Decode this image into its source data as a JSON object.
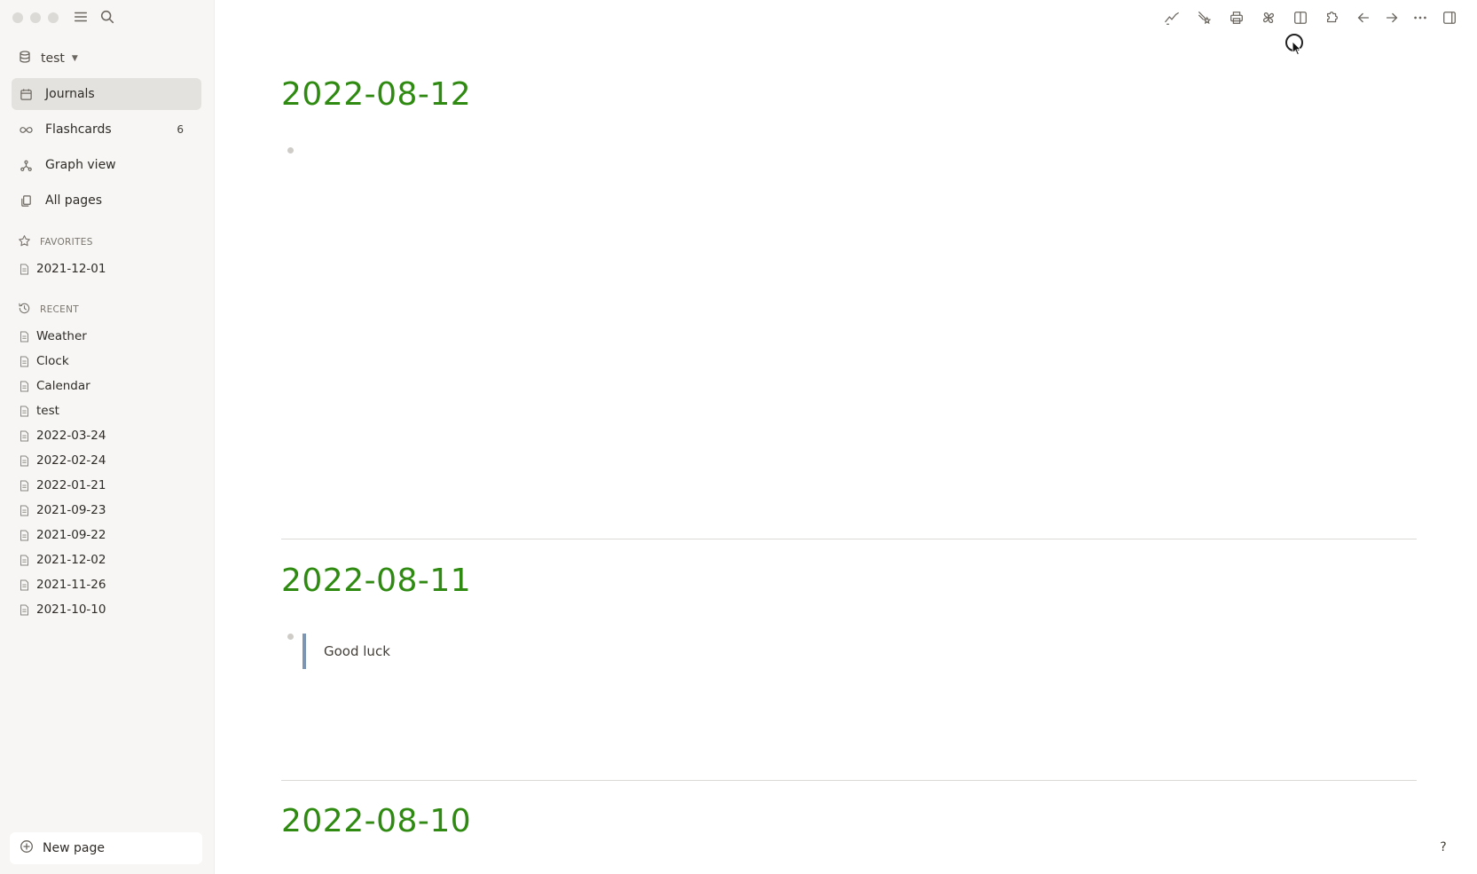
{
  "sidebar": {
    "graph_name": "test",
    "nav": [
      {
        "label": "Journals",
        "icon": "calendar-icon",
        "active": true
      },
      {
        "label": "Flashcards",
        "icon": "infinity-icon",
        "count": "6"
      },
      {
        "label": "Graph view",
        "icon": "graph-icon"
      },
      {
        "label": "All pages",
        "icon": "pages-icon"
      }
    ],
    "favorites_header": "FAVORITES",
    "favorites": [
      "2021-12-01"
    ],
    "recent_header": "RECENT",
    "recent": [
      "Weather",
      "Clock",
      "Calendar",
      "test",
      "2022-03-24",
      "2022-02-24",
      "2022-01-21",
      "2021-09-23",
      "2021-09-22",
      "2021-12-02",
      "2021-11-26",
      "2021-10-10"
    ],
    "new_page_label": "New page"
  },
  "toolbar": {
    "icons": [
      "trend-icon",
      "sparkle-icon",
      "print-icon",
      "puzzle-flower-icon",
      "split-view-icon",
      "plugin-icon",
      "back-arrow-icon",
      "forward-arrow-icon",
      "more-icon",
      "right-sidebar-icon"
    ]
  },
  "journals": [
    {
      "title": "2022-08-12",
      "blocks": []
    },
    {
      "title": "2022-08-11",
      "blocks": [
        {
          "type": "quote",
          "text": "Good luck"
        }
      ]
    },
    {
      "title": "2022-08-10",
      "blocks": []
    }
  ],
  "help_label": "?",
  "colors": {
    "accent_title": "#2e8a10",
    "sidebar_bg": "#f7f6f4",
    "active_item_bg": "#e4e2de",
    "quote_border": "#7c95b3"
  }
}
